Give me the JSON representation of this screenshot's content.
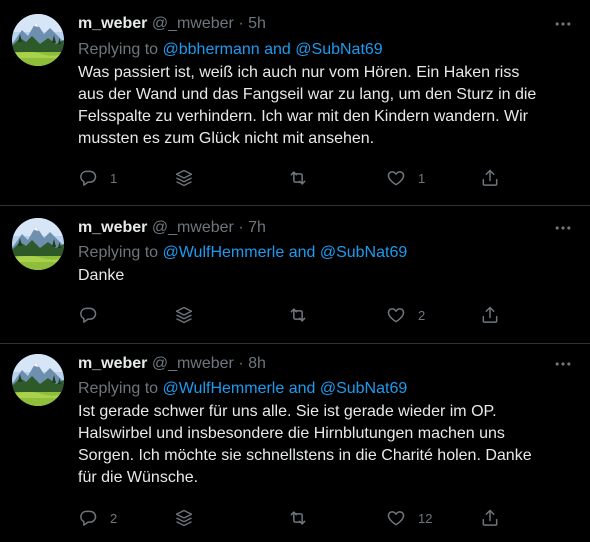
{
  "colors": {
    "background": "#000000",
    "text": "#e7e9ea",
    "muted": "#6e767d",
    "link": "#1d9bf0",
    "divider": "#2f3336"
  },
  "icons": [
    "avatar",
    "more-icon",
    "reply-icon",
    "stack-icon",
    "retweet-icon",
    "like-icon",
    "share-icon"
  ],
  "tweets": [
    {
      "display_name": "m_weber",
      "handle": "@_mweber",
      "separator": "·",
      "time": "5h",
      "replying_prefix": "Replying to",
      "replying_targets": "@bbhermann and @SubNat69",
      "lines": [
        "Was passiert ist, weiß ich auch nur vom Hören. Ein Haken riss",
        "aus der Wand und das Fangseil war zu lang, um den Sturz in die",
        "Felsspalte zu verhindern. Ich war mit den Kindern wandern. Wir",
        "mussten es zum Glück nicht mit ansehen."
      ],
      "reply_count": "1",
      "retweet_count": "",
      "like_count": "1"
    },
    {
      "display_name": "m_weber",
      "handle": "@_mweber",
      "separator": "·",
      "time": "7h",
      "replying_prefix": "Replying to",
      "replying_targets": "@WulfHemmerle and @SubNat69",
      "lines": [
        "Danke"
      ],
      "reply_count": "",
      "retweet_count": "",
      "like_count": "2"
    },
    {
      "display_name": "m_weber",
      "handle": "@_mweber",
      "separator": "·",
      "time": "8h",
      "replying_prefix": "Replying to",
      "replying_targets": "@WulfHemmerle and @SubNat69",
      "lines": [
        "Ist gerade schwer für uns alle. Sie ist gerade wieder im OP.",
        "Halswirbel und insbesondere die Hirnblutungen machen uns",
        "Sorgen. Ich möchte sie schnellstens in die Charité holen. Danke",
        "für die Wünsche."
      ],
      "reply_count": "2",
      "retweet_count": "",
      "like_count": "12"
    }
  ]
}
